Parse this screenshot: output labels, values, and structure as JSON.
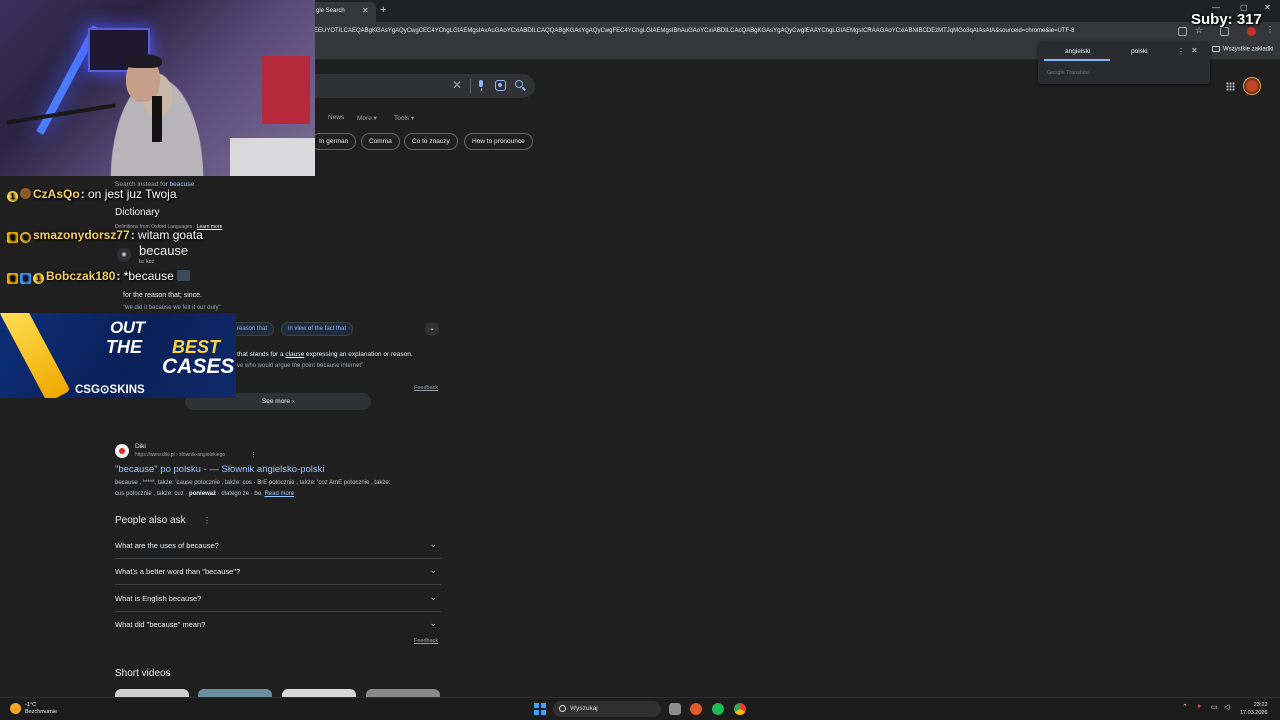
{
  "browser": {
    "tab_title": "gle Search",
    "address": "AEEUYOTILCAEQABgKGAsYgAQyCwgCEC4YChgLGIAEMgsIAxAuGAoYCxiABDILCAQQABgKGAsYgAQyCwgFEC4YChgLGIAEMgsIBhAuGAoYCxiABDILCAcQABgKGAsYgAQyCwgIEAAYChgLGIAEMgsICRAAGAoYCxiABNIBCDEzMTJqMGo3qAIAsAIA&sourceid=chrome&ie=UTF-8",
    "bookmarks_folder": "Wszystkie zakładki"
  },
  "translate": {
    "tab_source": "angielski",
    "tab_target": "polski",
    "brand": "Google Translate"
  },
  "search": {
    "filters": [
      "News",
      "More ▾",
      "Tools ▾"
    ],
    "chips": [
      "In german",
      "Comma",
      "Co to znaczy",
      "How to pronounce"
    ]
  },
  "dictionary": {
    "search_instead_prefix": "Search instead for ",
    "search_instead_term": "beacuse",
    "heading": "Dictionary",
    "source": "Definitions from Oxford Languages · ",
    "learn_more": "Learn more",
    "word": "because",
    "phonetic": "bɪˈkɒz",
    "definition": "for the reason that; since.",
    "example": "\"we did it because we felt it our duty\"",
    "similar_chips": [
      "reason that",
      "in view of the fact that"
    ],
    "usage_prefix": "that stands for a ",
    "usage_link": "clause",
    "usage_suffix": " expressing an explanation or reason.",
    "usage_example": "ve who would argue the point because internet\"",
    "feedback": "Feedback",
    "see_more": "See more"
  },
  "result": {
    "site_name": "Diki",
    "url": "https://www.diki.pl › slownik-angielskiego",
    "title": "\"because\" po polsku - — Słownik angielsko-polski",
    "snippet_line1": "because , *****, także: 'cause potocznie , także: cos · BrE potocznie , także: 'coz AmE potocznie , także:",
    "snippet_line2_a": "cus potocznie , także: cuz · ",
    "snippet_line2_b": "ponieważ",
    "snippet_line2_c": " · dlatego że · bo. ",
    "read_more": "Read more"
  },
  "paa": {
    "heading": "People also ask",
    "questions": [
      "What are the uses of because?",
      "What's a better word than \"because\"?",
      "What is English because?",
      "What did \"because\" mean?"
    ],
    "feedback": "Feedback"
  },
  "short_videos": {
    "heading": "Short videos"
  },
  "stream": {
    "subs": "Suby: 317",
    "chat": [
      {
        "user": "CzAsQo",
        "message": " on jest juz Twoja",
        "color": "#f5d05a"
      },
      {
        "user": "smazonydorsz77",
        "message": " witam goata",
        "color": "#f5d05a"
      },
      {
        "user": "Bobczak180",
        "message": " *because",
        "color": "#f5d05a"
      }
    ],
    "ad": {
      "line1": "OUT",
      "line2a": "THE",
      "line2b": "BEST",
      "line3": "CASES",
      "brand": "CSG⊙SKINS"
    }
  },
  "taskbar": {
    "weather_temp": "-1°C",
    "weather_desc": "Bezchmurnie",
    "search_placeholder": "Wyszukaj",
    "time": "23:22",
    "date": "17.03.2026"
  }
}
